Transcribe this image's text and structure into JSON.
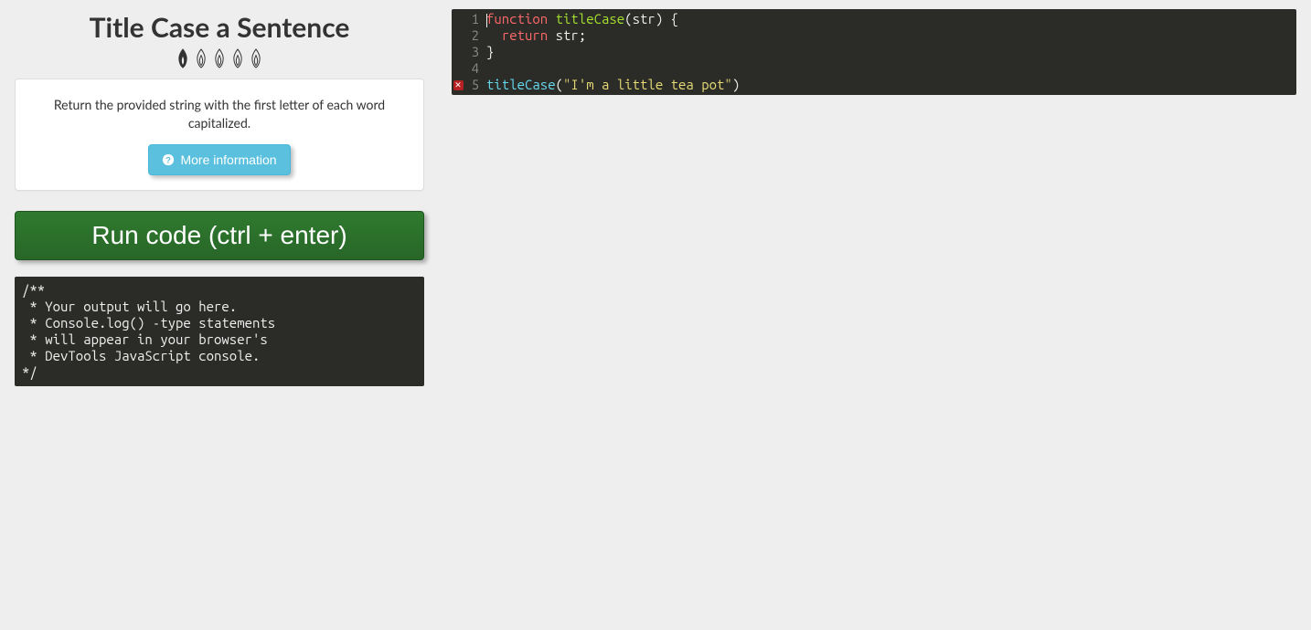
{
  "title": "Title Case a Sentence",
  "difficulty": {
    "filled": 1,
    "total": 5
  },
  "description": "Return the provided string with the first letter of each word capitalized.",
  "more_info_label": "More information",
  "run_label": "Run code (ctrl + enter)",
  "output_text": "/**\n * Your output will go here.\n * Console.log() -type statements\n * will appear in your browser's\n * DevTools JavaScript console.\n*/",
  "editor": {
    "lines": [
      {
        "num": "1",
        "marker": "",
        "tokens": [
          {
            "t": "function ",
            "c": "tok-keyword"
          },
          {
            "t": "titleCase",
            "c": "tok-def"
          },
          {
            "t": "(",
            "c": "tok-punct"
          },
          {
            "t": "str",
            "c": "tok-var"
          },
          {
            "t": ") {",
            "c": "tok-punct"
          }
        ],
        "cursor": true
      },
      {
        "num": "2",
        "marker": "",
        "tokens": [
          {
            "t": "  ",
            "c": "tok-punct"
          },
          {
            "t": "return ",
            "c": "tok-keyword"
          },
          {
            "t": "str",
            "c": "tok-var"
          },
          {
            "t": ";",
            "c": "tok-punct"
          }
        ]
      },
      {
        "num": "3",
        "marker": "",
        "tokens": [
          {
            "t": "}",
            "c": "tok-punct"
          }
        ]
      },
      {
        "num": "4",
        "marker": "",
        "tokens": []
      },
      {
        "num": "5",
        "marker": "error",
        "tokens": [
          {
            "t": "titleCase",
            "c": "tok-call"
          },
          {
            "t": "(",
            "c": "tok-punct"
          },
          {
            "t": "\"I'm a little tea pot\"",
            "c": "tok-string"
          },
          {
            "t": ")",
            "c": "tok-punct"
          }
        ]
      }
    ]
  }
}
